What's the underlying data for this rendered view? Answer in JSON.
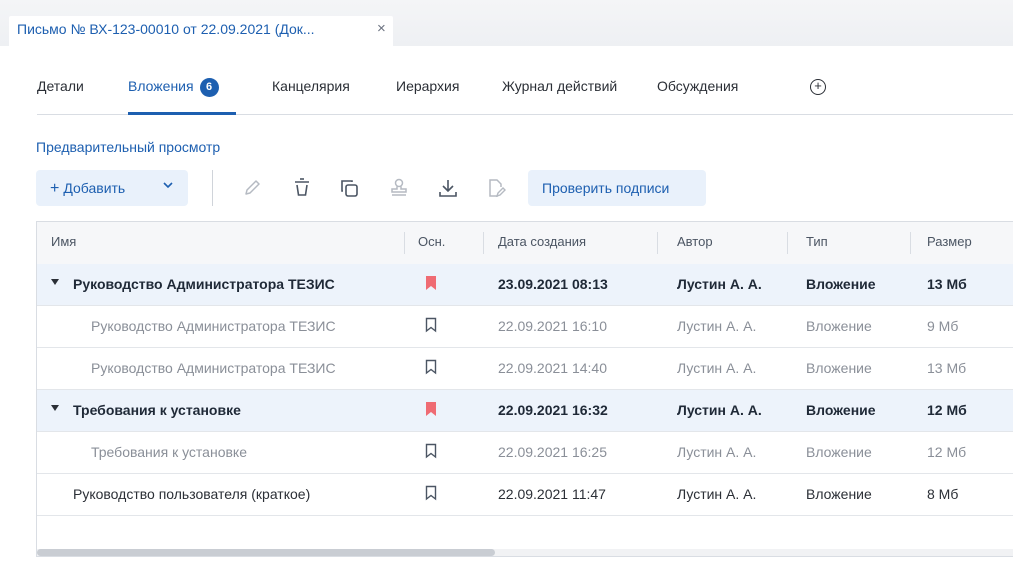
{
  "doc_tab": {
    "title": "Письмо № ВХ-123-00010 от 22.09.2021 (Док...",
    "close": "×"
  },
  "tabs": [
    {
      "label": "Детали"
    },
    {
      "label": "Вложения",
      "badge": "6"
    },
    {
      "label": "Канцелярия"
    },
    {
      "label": "Иерархия"
    },
    {
      "label": "Журнал действий"
    },
    {
      "label": "Обсуждения"
    }
  ],
  "add_tab_symbol": "+",
  "preview_link": "Предварительный просмотр",
  "toolbar": {
    "add_label": "Добавить",
    "add_plus": "+",
    "add_chevron": "⌄",
    "verify_label": "Проверить подписи",
    "icons": [
      "pencil-icon",
      "delete-icon",
      "copy-icon",
      "stamp-icon",
      "download-icon",
      "sign-file-icon"
    ]
  },
  "grid": {
    "columns": [
      "Имя",
      "Осн.",
      "Дата создания",
      "Автор",
      "Тип",
      "Размер"
    ],
    "rows": [
      {
        "name": "Руководство Администратора ТЕЗИС",
        "main": true,
        "date": "23.09.2021 08:13",
        "author": "Лустин А. А.",
        "type": "Вложение",
        "size": "13 Мб"
      },
      {
        "name": "Руководство Администратора ТЕЗИС",
        "main": false,
        "date": "22.09.2021 16:10",
        "author": "Лустин А. А.",
        "type": "Вложение",
        "size": "9 Мб"
      },
      {
        "name": "Руководство Администратора ТЕЗИС",
        "main": false,
        "date": "22.09.2021 14:40",
        "author": "Лустин А. А.",
        "type": "Вложение",
        "size": "13 Мб"
      },
      {
        "name": "Требования к установке",
        "main": true,
        "date": "22.09.2021 16:32",
        "author": "Лустин А. А.",
        "type": "Вложение",
        "size": "12 Мб"
      },
      {
        "name": "Требования к установке",
        "main": false,
        "date": "22.09.2021 16:25",
        "author": "Лустин А. А.",
        "type": "Вложение",
        "size": "12 Мб"
      },
      {
        "name": "Руководство пользователя (краткое)",
        "main": false,
        "date": "22.09.2021 11:47",
        "author": "Лустин А. А.",
        "type": "Вложение",
        "size": "8 Мб"
      }
    ]
  },
  "colors": {
    "accent": "#1d5fb0",
    "bookmark_main": "#ef6b73",
    "group_row_bg": "#edf3fb"
  }
}
